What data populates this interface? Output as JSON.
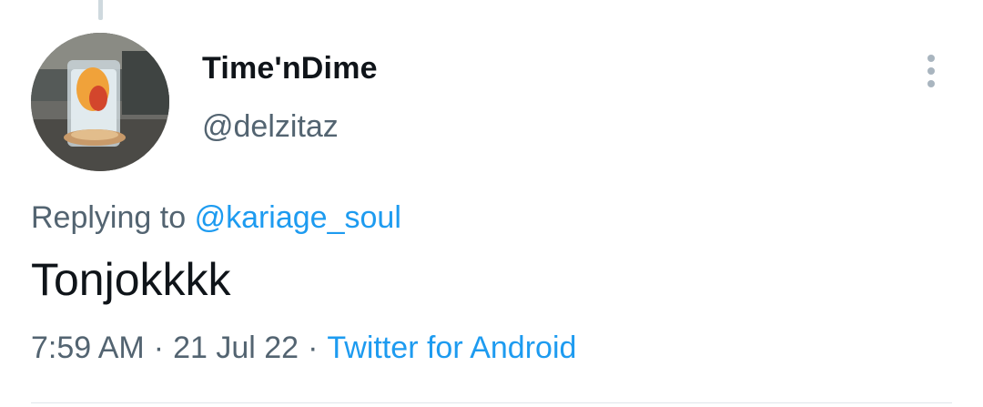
{
  "tweet": {
    "author": {
      "display_name": "Time'nDime",
      "handle": "@delzitaz"
    },
    "replying_prefix": "Replying to",
    "replying_to": "@kariage_soul",
    "text": "Tonjokkkk",
    "time": "7:59 AM",
    "separator": "·",
    "date": "21 Jul 22",
    "source": "Twitter for Android"
  },
  "icons": {
    "more": "more-vertical-icon",
    "avatar": "avatar-photo-glass-drink"
  },
  "colors": {
    "primary_text": "#0f1419",
    "secondary_text": "#536471",
    "link": "#1d9bf0",
    "thread_line": "#cfd9de",
    "divider": "#dfe5ea"
  }
}
